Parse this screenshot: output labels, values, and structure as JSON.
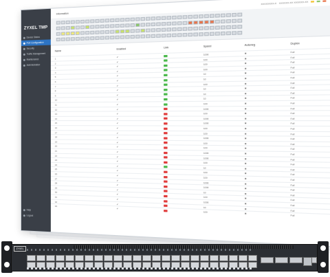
{
  "app": {
    "logo_text": "ZYXEL TMP",
    "tab_label": "Information",
    "status_left": "XXXXXXXX-X",
    "status_mid": "XXXXXX-XX XXXXXX-XX",
    "colors": {
      "accent": "#2d74c4",
      "sidebar_bg": "#3a3f47",
      "link_up": "#49b84a",
      "link_down": "#e03c3c"
    }
  },
  "sidebar": {
    "items": [
      {
        "label": "Device Status",
        "icon": "home-icon",
        "active": false
      },
      {
        "label": "Port Configuration",
        "icon": "port-icon",
        "active": true
      },
      {
        "label": "Security",
        "icon": "shield-icon",
        "active": false
      },
      {
        "label": "Traffic Management",
        "icon": "traffic-icon",
        "active": false
      },
      {
        "label": "Maintenance",
        "icon": "wrench-icon",
        "active": false
      },
      {
        "label": "Administration",
        "icon": "admin-icon",
        "active": false
      }
    ],
    "bottom": [
      {
        "label": "Help",
        "icon": "help-icon"
      },
      {
        "label": "Logout",
        "icon": "logout-icon"
      }
    ]
  },
  "table": {
    "headers": [
      "Name",
      "Enabled",
      "Link",
      "Speed",
      "Autoneg",
      "Duplex"
    ],
    "rows": [
      {
        "name": "1",
        "enabled": "✔",
        "link": "up",
        "speed": "1000",
        "autoneg": "✖",
        "duplex": "Full"
      },
      {
        "name": "2",
        "enabled": "✔",
        "link": "up",
        "speed": "100",
        "autoneg": "✖",
        "duplex": "Full"
      },
      {
        "name": "3",
        "enabled": "✔",
        "link": "up",
        "speed": "100",
        "autoneg": "✖",
        "duplex": "Full"
      },
      {
        "name": "4",
        "enabled": "✔",
        "link": "up",
        "speed": "100",
        "autoneg": "✖",
        "duplex": "Full"
      },
      {
        "name": "5",
        "enabled": "✔",
        "link": "up",
        "speed": "10",
        "autoneg": "✖",
        "duplex": "Full"
      },
      {
        "name": "6",
        "enabled": "✔",
        "link": "up",
        "speed": "10",
        "autoneg": "✖",
        "duplex": "Full"
      },
      {
        "name": "7",
        "enabled": "✔",
        "link": "up",
        "speed": "100",
        "autoneg": "✖",
        "duplex": "Full"
      },
      {
        "name": "8",
        "enabled": "✔",
        "link": "up",
        "speed": "10",
        "autoneg": "✖",
        "duplex": "Full"
      },
      {
        "name": "9",
        "enabled": "✔",
        "link": "up",
        "speed": "10",
        "autoneg": "✖",
        "duplex": "Full"
      },
      {
        "name": "10",
        "enabled": "✔",
        "link": "up",
        "speed": "10",
        "autoneg": "✖",
        "duplex": "Full"
      },
      {
        "name": "11",
        "enabled": "✔",
        "link": "up",
        "speed": "100",
        "autoneg": "✖",
        "duplex": "Full"
      },
      {
        "name": "12",
        "enabled": "✔",
        "link": "down",
        "speed": "1000",
        "autoneg": "✖",
        "duplex": "Full"
      },
      {
        "name": "13",
        "enabled": "✔",
        "link": "down",
        "speed": "100",
        "autoneg": "✖",
        "duplex": "Full"
      },
      {
        "name": "14",
        "enabled": "✔",
        "link": "down",
        "speed": "1000",
        "autoneg": "✖",
        "duplex": "Full"
      },
      {
        "name": "15",
        "enabled": "✔",
        "link": "down",
        "speed": "1000",
        "autoneg": "✖",
        "duplex": "Full"
      },
      {
        "name": "16",
        "enabled": "✔",
        "link": "down",
        "speed": "100",
        "autoneg": "✖",
        "duplex": "Full"
      },
      {
        "name": "17",
        "enabled": "✔",
        "link": "down",
        "speed": "100",
        "autoneg": "✖",
        "duplex": "Full"
      },
      {
        "name": "18",
        "enabled": "✔",
        "link": "down",
        "speed": "1000",
        "autoneg": "✖",
        "duplex": "Full"
      },
      {
        "name": "19",
        "enabled": "✔",
        "link": "down",
        "speed": "100",
        "autoneg": "✖",
        "duplex": "Full"
      },
      {
        "name": "20",
        "enabled": "✔",
        "link": "down",
        "speed": "100",
        "autoneg": "✖",
        "duplex": "Full"
      },
      {
        "name": "21",
        "enabled": "✔",
        "link": "down",
        "speed": "1000",
        "autoneg": "✖",
        "duplex": "Full"
      },
      {
        "name": "22",
        "enabled": "✔",
        "link": "down",
        "speed": "1000",
        "autoneg": "✖",
        "duplex": "Full"
      },
      {
        "name": "23",
        "enabled": "✔",
        "link": "down",
        "speed": "100",
        "autoneg": "✖",
        "duplex": "Full"
      },
      {
        "name": "24",
        "enabled": "✔",
        "link": "up",
        "speed": "10",
        "autoneg": "✖",
        "duplex": "Full"
      },
      {
        "name": "25",
        "enabled": "✔",
        "link": "down",
        "speed": "100",
        "autoneg": "✖",
        "duplex": "Full"
      },
      {
        "name": "26",
        "enabled": "✔",
        "link": "down",
        "speed": "100",
        "autoneg": "✖",
        "duplex": "Full"
      },
      {
        "name": "27",
        "enabled": "✔",
        "link": "down",
        "speed": "1000",
        "autoneg": "✖",
        "duplex": "Full"
      },
      {
        "name": "28",
        "enabled": "✔",
        "link": "down",
        "speed": "1000",
        "autoneg": "✖",
        "duplex": "Full"
      },
      {
        "name": "29",
        "enabled": "✔",
        "link": "down",
        "speed": "10",
        "autoneg": "✖",
        "duplex": "Full"
      },
      {
        "name": "30",
        "enabled": "✔",
        "link": "down",
        "speed": "100",
        "autoneg": "✖",
        "duplex": "Full"
      },
      {
        "name": "31",
        "enabled": "✔",
        "link": "down",
        "speed": "1000",
        "autoneg": "✖",
        "duplex": "Full"
      },
      {
        "name": "32",
        "enabled": "✔",
        "link": "down",
        "speed": "10",
        "autoneg": "✖",
        "duplex": "Full"
      },
      {
        "name": "33",
        "enabled": "✔",
        "link": "down",
        "speed": "100",
        "autoneg": "✖",
        "duplex": "Full"
      }
    ]
  },
  "port_panel": {
    "top_row": [
      "n",
      "n",
      "n",
      "n",
      "n",
      "n",
      "n",
      "n",
      "n",
      "n",
      "n",
      "n",
      "n",
      "n",
      "n",
      "n",
      "n",
      "n",
      "n",
      "n",
      "n",
      "n",
      "n",
      "n",
      "n",
      "n",
      "n",
      "n",
      "n",
      "n",
      "n",
      "n",
      "n",
      "n",
      "n",
      "n"
    ],
    "row2": [
      "n",
      "n",
      "n",
      "lime",
      "n",
      "n",
      "lime",
      "n",
      "n",
      "n",
      "n",
      "n",
      "n",
      "n",
      "n",
      "n",
      "green",
      "n",
      "n",
      "n",
      "n",
      "n",
      "n",
      "n",
      "n",
      "n",
      "orange",
      "orange",
      "orange",
      "orange",
      "orange",
      "n",
      "n",
      "n",
      "n",
      "n"
    ],
    "row3": [
      "n",
      "yellow",
      "yellow",
      "yellow",
      "yellow",
      "n",
      "n",
      "n",
      "n",
      "n",
      "n",
      "n",
      "lime",
      "lime",
      "lime",
      "n",
      "n",
      "lime",
      "n",
      "n",
      "n",
      "n",
      "n",
      "n",
      "n",
      "n",
      "n",
      "n",
      "n",
      "n",
      "n",
      "n",
      "n",
      "n",
      "n",
      "n"
    ],
    "row4": [
      "n",
      "n",
      "n",
      "n",
      "n",
      "n",
      "n",
      "n",
      "n",
      "n",
      "n",
      "n",
      "n",
      "n",
      "n",
      "n",
      "n",
      "n",
      "n",
      "n",
      "n",
      "n",
      "n",
      "n",
      "n",
      "n",
      "n",
      "n",
      "n",
      "n",
      "n",
      "n",
      "n",
      "n",
      "n",
      "n"
    ]
  },
  "switch": {
    "logo": "ZYXEL",
    "sfp_ports_per_block": 24,
    "qsfp_ports": 4
  }
}
